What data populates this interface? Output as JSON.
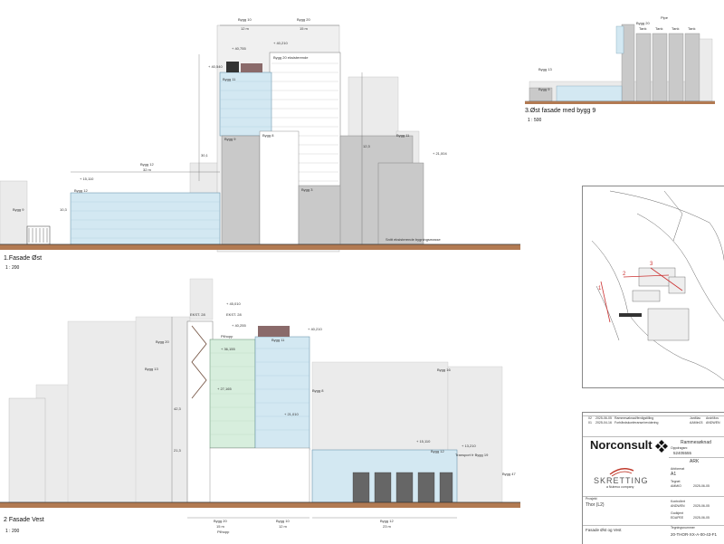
{
  "views": {
    "east": {
      "title": "1.Fasade Øst",
      "scale": "1 : 200"
    },
    "west": {
      "title": "2 Fasade Vest",
      "scale": "1 : 200"
    },
    "east9": {
      "title": "3.Øst fasade med bygg 9",
      "scale": "1 : 500"
    }
  },
  "east_labels": {
    "bygg10": "Bygg 10",
    "bygg10_w": "12 m",
    "bygg20": "Bygg 20",
    "bygg20_w": "15 m",
    "bygg20_note": "Bygg 20 eksisterende",
    "bygg11_top": "Bygg 11",
    "bygg12": "Bygg 12",
    "bygg12_w": "32 m",
    "bygg12_tag": "Bygg 12",
    "bygg9": "Bygg 9",
    "bygg8": "Bygg 8",
    "bygg11": "Bygg 11",
    "bygg3": "Bygg 3",
    "bygg_low": "Bygg 9",
    "lev1": "+ 40,755",
    "lev2": "+ 40,210",
    "lev3": "+ 40,540",
    "lev4": "+ 15,110",
    "lev5": "+ 21,004",
    "dim1": "30,1",
    "dim2": "12,3",
    "dim3": "10,3",
    "ground_note": "Snitt eksisterende bygningsmasse"
  },
  "west_labels": {
    "ekst1": "EKST. 28",
    "ekst2": "EKST. 28",
    "bygg20": "Bygg 20",
    "bygg13": "Bygg 13",
    "bygg11": "Bygg 11",
    "bygg16": "Bygg 16",
    "bygg8": "Bygg 8",
    "bygg12": "Bygg 12",
    "transport": "Transport fr Bygg 19",
    "bygg47": "Bygg 47",
    "pilhopp": "Pilhopp",
    "lev1": "+ 45,010",
    "lev2": "+ 40,255",
    "lev3": "+ 36,155",
    "lev4": "+ 27,165",
    "lev5": "+ 21,010",
    "lev6": "+ 15,110",
    "lev7": "+ 13,210",
    "lev8": "+ 40,210",
    "dim_h": "42,3",
    "dim_b": "21,3",
    "b_bygg20": "Bygg 20",
    "b_bygg20_w": "15 m",
    "b_bygg10": "Bygg 10",
    "b_bygg10_w": "12 m",
    "b_bygg12": "Bygg 12",
    "b_bygg12_w": "23 m",
    "b_pilhopp": "Pilhopp"
  },
  "east9_labels": {
    "tank1": "Tank",
    "tank2": "Tank",
    "tank3": "Tank",
    "tank4": "Tank",
    "pipe": "Pipe",
    "bygg20": "Bygg 20",
    "bygg13": "Bygg 13",
    "bygg9": "Bygg 9"
  },
  "map_labels": {
    "n1": "1",
    "n2": "2",
    "n3": "3"
  },
  "titleblock": {
    "rev2": "02",
    "rev2_date": "2025-06-05",
    "rev2_desc": "Rammesøknad/ferdigstilling",
    "rev2_by": "JanMac",
    "rev2_chk": "AndrMos",
    "rev1": "01",
    "rev1_date": "2025-04-16",
    "rev1_desc": "Forhåndskonferanse/revidering",
    "rev1_by": "AAMIn03",
    "rev1_chk": "ANDWEN",
    "company": "Norconsult",
    "status": "Rammesøknad",
    "proj_no_lbl": "Oppdragsnr.",
    "proj_no": "52405555",
    "discipline": "ARK",
    "format_lbl": "Arkformat",
    "format": "A1",
    "client": "SKRETTING",
    "client_sub": "a Nutreco company",
    "project_lbl": "Prosjekt",
    "project": "Thor (L2)",
    "drawn_lbl": "Tegnet",
    "drawn": "AMMIO",
    "checked_lbl": "Kontrollert",
    "checked": "ANDWEN",
    "approved_lbl": "Godkjent",
    "approved": "EDAPEE",
    "date1": "2025-06-05",
    "date2": "2025-06-05",
    "date3": "2025-06-05",
    "sheet_title": "Fasade Øst og Vest",
    "drawing_no_lbl": "Tegningsnummer",
    "drawing_no": "20-THOR-XX-A-00-43-F1"
  },
  "colors": {
    "new_building_blue": "#d3e8f2",
    "new_building_green": "#d7eedd",
    "existing_grey": "#c9c9c9",
    "existing_light": "#ebebeb",
    "ground": "#b27a52"
  }
}
